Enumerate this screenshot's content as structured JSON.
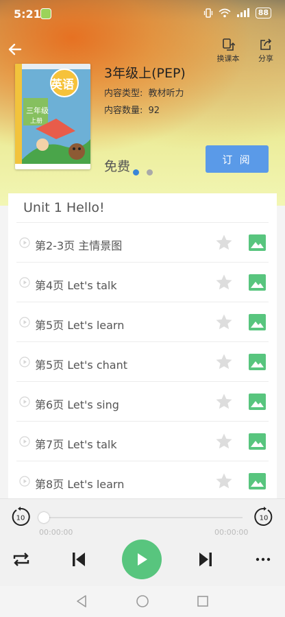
{
  "status_bar": {
    "time": "5:21",
    "battery": "88",
    "icons": [
      "app-notification-icon",
      "vibrate-icon",
      "wifi-icon",
      "signal-icon",
      "battery-icon"
    ]
  },
  "header": {
    "back_icon": "arrow-left-icon",
    "switch_textbook_label": "换课本",
    "share_label": "分享"
  },
  "book": {
    "cover_subject": "英语",
    "cover_grade": "三年级",
    "cover_term": "上册",
    "title": "3年级上(PEP)",
    "content_type_label": "内容类型:",
    "content_type_value": "教材听力",
    "content_count_label": "内容数量:",
    "content_count_value": "92",
    "price": "免费",
    "subscribe_label": "订 阅",
    "carousel_dots": 2,
    "carousel_active": 0
  },
  "unit": {
    "title": "Unit 1 Hello!",
    "tracks": [
      {
        "title": "第2-3页 主情景图"
      },
      {
        "title": "第4页 Let's talk"
      },
      {
        "title": "第5页 Let's learn"
      },
      {
        "title": "第5页 Let's chant"
      },
      {
        "title": "第6页 Let's sing"
      },
      {
        "title": "第7页 Let's talk"
      },
      {
        "title": "第8页 Let's learn"
      }
    ]
  },
  "player": {
    "elapsed": "00:00:00",
    "duration": "00:00:00",
    "progress": 0,
    "rewind_seconds": "10",
    "forward_seconds": "10"
  },
  "colors": {
    "accent_green": "#58c57e",
    "subscribe_blue": "#5a9ae8",
    "dot_active": "#3a86d8",
    "dot_inactive": "#a9a9a9",
    "star_gray": "#dddddd"
  }
}
